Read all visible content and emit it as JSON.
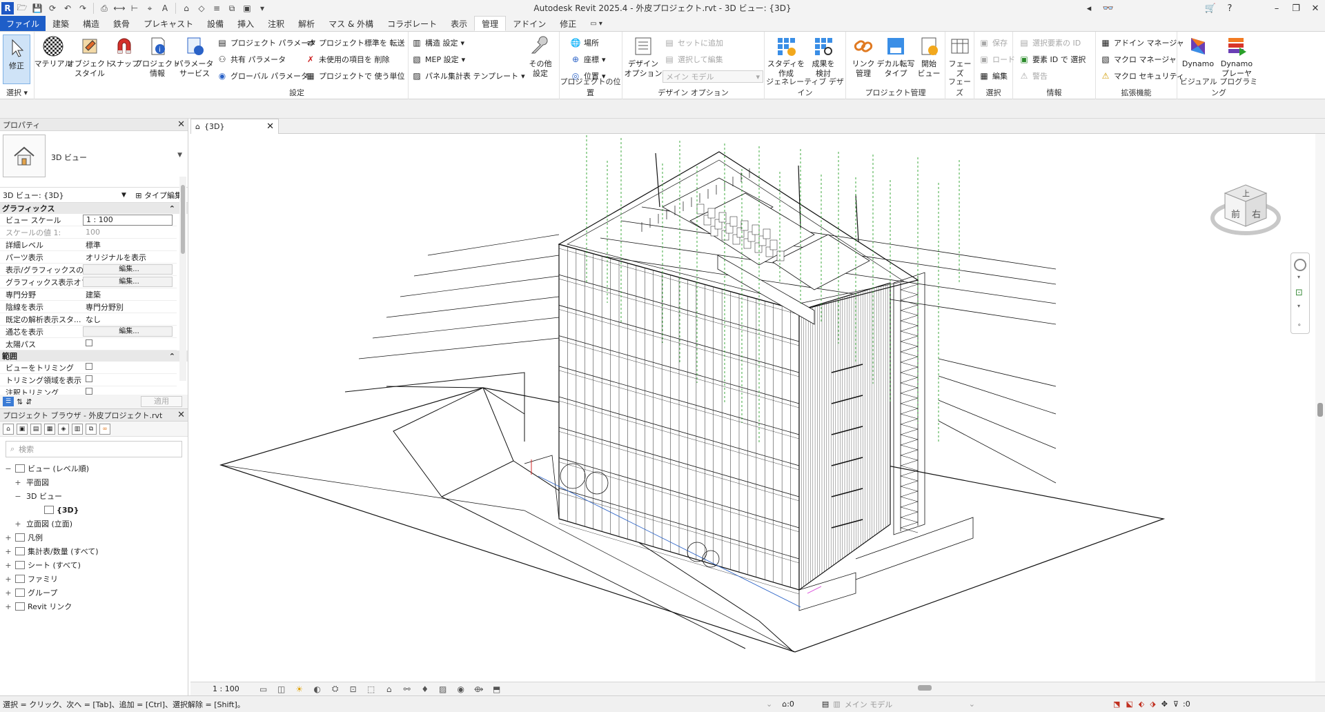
{
  "titlebar": {
    "title": "Autodesk Revit 2025.4 - 外皮プロジェクト.rvt - 3D ビュー: {3D}",
    "app_letter": "R"
  },
  "tabs": [
    "ファイル",
    "建築",
    "構造",
    "鉄骨",
    "プレキャスト",
    "設備",
    "挿入",
    "注釈",
    "解析",
    "マス & 外構",
    "コラボレート",
    "表示",
    "管理",
    "アドイン",
    "修正"
  ],
  "active_tab": "管理",
  "ribbon": {
    "select_label": "選択",
    "modify": "修正",
    "settings": {
      "label": "設定",
      "big": [
        {
          "name": "material",
          "label": "マテリアル"
        },
        {
          "name": "object-style",
          "label": "オブジェクト\nスタイル"
        },
        {
          "name": "snap",
          "label": "スナップ"
        },
        {
          "name": "project-info",
          "label": "プロジェクト\n情報"
        },
        {
          "name": "param-service",
          "label": "パラメータ\nサービス"
        }
      ],
      "small_col1": [
        "プロジェクト パラメータ",
        "共有 パラメータ",
        "グローバル パラメータ"
      ],
      "small_col2": [
        "プロジェクト標準を 転送",
        "未使用の項目を 削除",
        "プロジェクトで 使う単位"
      ],
      "small_col3": [
        "構造 設定",
        "MEP 設定",
        "パネル集計表 テンプレート"
      ],
      "other": "その他\n設定"
    },
    "location": {
      "label": "プロジェクトの位置",
      "items": [
        "場所",
        "座標",
        "位置"
      ]
    },
    "design_options": {
      "label": "デザイン オプション",
      "big": "デザイン\nオプション",
      "small": [
        "セットに追加",
        "選択して編集"
      ],
      "dropdown": "メイン モデル"
    },
    "generative": {
      "label": "ジェネレーティブ デザイン",
      "big": [
        "スタディを\n作成",
        "成果を\n検討"
      ]
    },
    "project_mgmt": {
      "label": "プロジェクト管理",
      "big": [
        "リンク\n管理",
        "デカル転写\nタイプ",
        "開始\nビュー"
      ]
    },
    "phases": {
      "label": "フェーズ",
      "big": "フェーズ"
    },
    "selection": {
      "label": "選択",
      "small": [
        "保存",
        "ロード",
        "編集"
      ]
    },
    "inquiry": {
      "label": "情報",
      "small": [
        "選択要素の ID",
        "要素 ID で 選択",
        "警告"
      ]
    },
    "macros": {
      "label": "拡張機能",
      "small": [
        "アドイン マネージャ",
        "マクロ マネージャ",
        "マクロ セキュリティ"
      ]
    },
    "visual": {
      "label": "ビジュアル プログラミング",
      "big": [
        "Dynamo",
        "Dynamo\nプレーヤ"
      ]
    }
  },
  "properties": {
    "title": "プロパティ",
    "type_name": "3D ビュー",
    "selector": "3D ビュー: {3D}",
    "edit_type": "タイプ編集",
    "graphics_header": "グラフィックス",
    "rows": [
      {
        "k": "ビュー スケール",
        "v": "1 : 100",
        "style": "box"
      },
      {
        "k": "スケールの値    1:",
        "v": "100",
        "style": "dis"
      },
      {
        "k": "詳細レベル",
        "v": "標準"
      },
      {
        "k": "パーツ表示",
        "v": "オリジナルを表示"
      },
      {
        "k": "表示/グラフィックスの...",
        "v": "編集...",
        "style": "btn"
      },
      {
        "k": "グラフィックス表示オプ...",
        "v": "編集...",
        "style": "btn"
      },
      {
        "k": "専門分野",
        "v": "建築"
      },
      {
        "k": "陰線を表示",
        "v": "専門分野別"
      },
      {
        "k": "既定の解析表示スタ...",
        "v": "なし"
      },
      {
        "k": "通芯を表示",
        "v": "編集...",
        "style": "btn"
      },
      {
        "k": "太陽パス",
        "v": "",
        "style": "chk"
      }
    ],
    "extent_header": "範囲",
    "extent_rows": [
      {
        "k": "ビューをトリミング",
        "v": "",
        "style": "chk"
      },
      {
        "k": "トリミング領域を表示",
        "v": "",
        "style": "chk"
      },
      {
        "k": "注釈トリミング",
        "v": "",
        "style": "chk"
      }
    ],
    "apply": "適用"
  },
  "browser": {
    "title": "プロジェクト ブラウザ - 外皮プロジェクト.rvt",
    "search_placeholder": "検索",
    "tree": [
      {
        "label": "ビュー (レベル順)",
        "pm": "−",
        "indent": 0,
        "icon": true
      },
      {
        "label": "平面図",
        "pm": "+",
        "indent": 1,
        "icon": false
      },
      {
        "label": "3D ビュー",
        "pm": "−",
        "indent": 1,
        "icon": false
      },
      {
        "label": "{3D}",
        "pm": "",
        "indent": 3,
        "icon": true,
        "bold": true
      },
      {
        "label": "立面図 (立面)",
        "pm": "+",
        "indent": 1,
        "icon": false
      },
      {
        "label": "凡例",
        "pm": "+",
        "indent": 0,
        "icon": true
      },
      {
        "label": "集計表/数量 (すべて)",
        "pm": "+",
        "indent": 0,
        "icon": true
      },
      {
        "label": "シート (すべて)",
        "pm": "+",
        "indent": 0,
        "icon": true
      },
      {
        "label": "ファミリ",
        "pm": "+",
        "indent": 0,
        "icon": true
      },
      {
        "label": "グループ",
        "pm": "+",
        "indent": 0,
        "icon": true
      },
      {
        "label": "Revit リンク",
        "pm": "+",
        "indent": 0,
        "icon": true
      }
    ]
  },
  "view": {
    "tab_label": "{3D}",
    "scale": "1 : 100",
    "viewcube": {
      "top": "上",
      "front": "前",
      "right": "右"
    }
  },
  "status": {
    "message": "選択 = クリック、次へ = [Tab]、追加 = [Ctrl]、選択解除 = [Shift]。",
    "zero1": ":0",
    "model": "メイン モデル",
    "filter_count": ":0"
  },
  "colors": {
    "accent": "#1e5ec8",
    "guide": "#2aa02a",
    "line": "#111111"
  }
}
